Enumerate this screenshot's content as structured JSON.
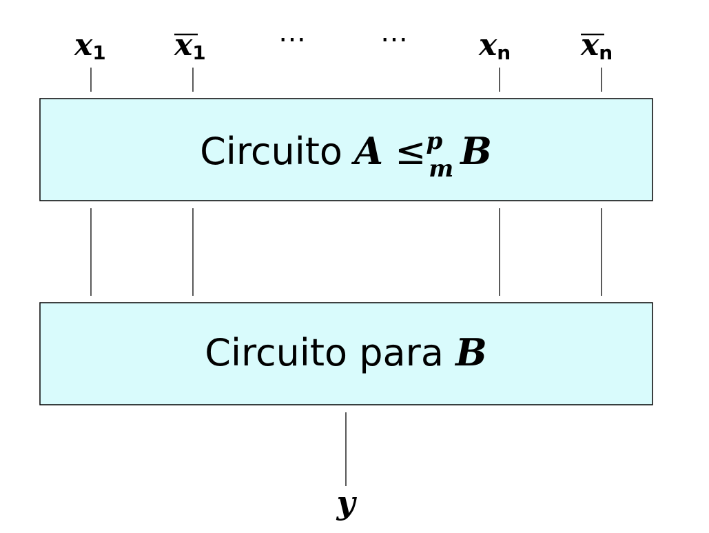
{
  "colors": {
    "box_fill": "#d9fbfc",
    "stroke": "#000000"
  },
  "inputs": [
    {
      "var": "x",
      "sub": "1",
      "bar": false
    },
    {
      "var": "x",
      "sub": "1",
      "bar": true
    },
    {
      "var": "⋯"
    },
    {
      "var": "⋯"
    },
    {
      "var": "x",
      "sub": "n",
      "bar": false
    },
    {
      "var": "x",
      "sub": "n",
      "bar": true
    }
  ],
  "reduction_box": {
    "prefix": "Circuito",
    "left": "A",
    "rel": "≤",
    "sup": "p",
    "sub": "m",
    "right": "B"
  },
  "circuit_box": {
    "prefix": "Circuito para",
    "var": "B"
  },
  "output": {
    "var": "y"
  }
}
